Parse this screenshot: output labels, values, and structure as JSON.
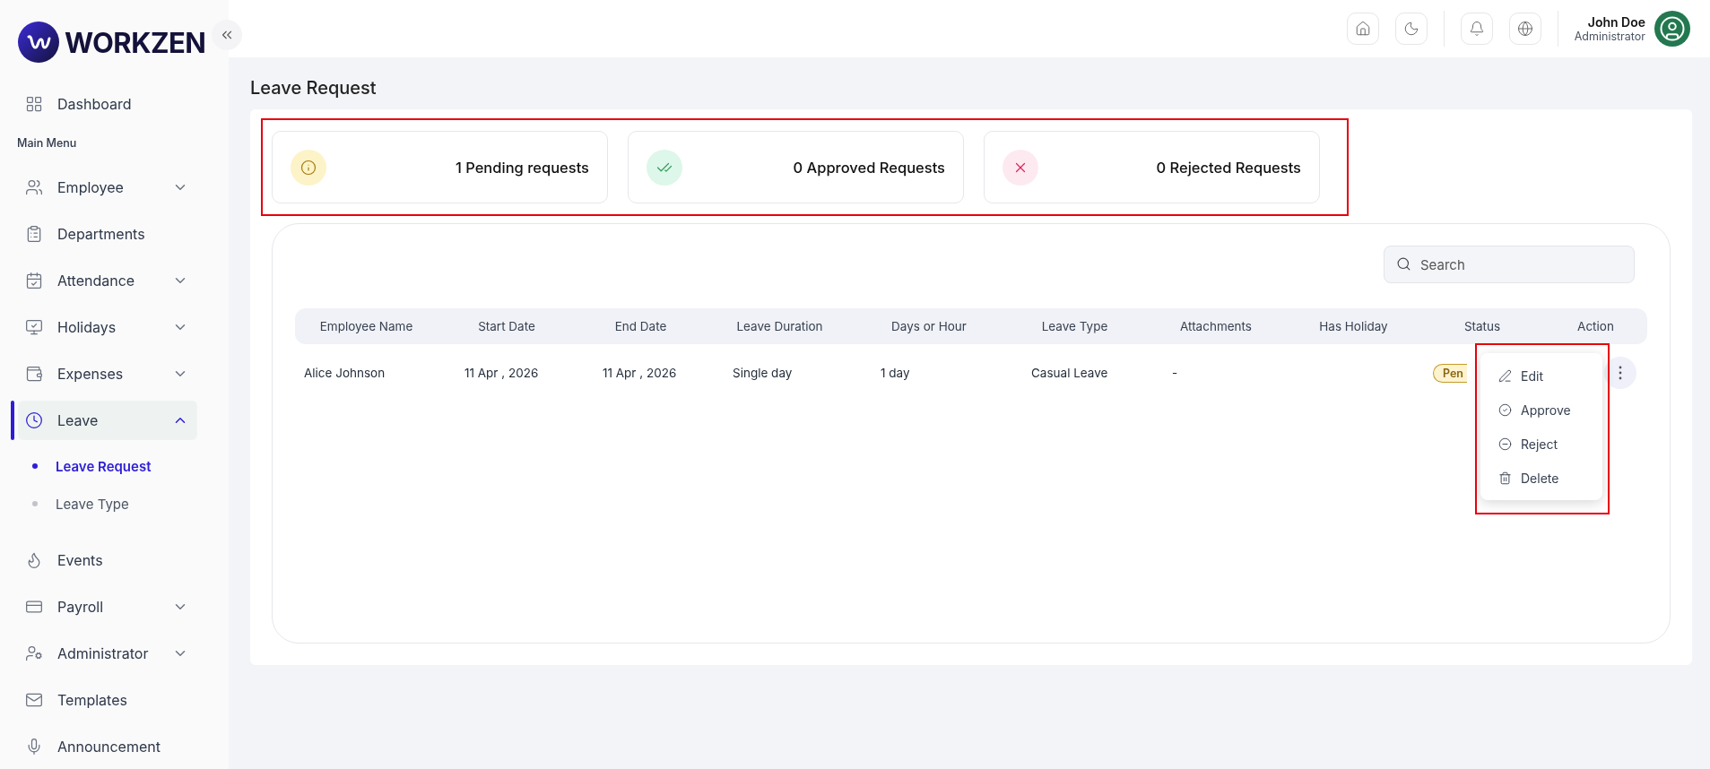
{
  "sidebar": {
    "logo": "WORKZEN",
    "top_items": [
      {
        "label": "Dashboard",
        "selected": false
      }
    ],
    "section_title": "Main Menu",
    "items": [
      {
        "label": "Employee",
        "kind": "group",
        "expanded": false,
        "selected": false
      },
      {
        "label": "Departments",
        "kind": "link",
        "selected": false
      },
      {
        "label": "Attendance",
        "kind": "group",
        "expanded": false,
        "selected": false
      },
      {
        "label": "Holidays",
        "kind": "group",
        "expanded": false,
        "selected": false
      },
      {
        "label": "Expenses",
        "kind": "group",
        "expanded": false,
        "selected": false
      },
      {
        "label": "Leave",
        "kind": "group",
        "expanded": true,
        "selected": true,
        "children": [
          {
            "label": "Leave Request",
            "selected": true
          },
          {
            "label": "Leave Type",
            "selected": false
          }
        ]
      },
      {
        "label": "Events",
        "kind": "link",
        "selected": false
      },
      {
        "label": "Payroll",
        "kind": "group",
        "expanded": false,
        "selected": false
      },
      {
        "label": "Administrator",
        "kind": "group",
        "expanded": false,
        "selected": false
      },
      {
        "label": "Templates",
        "kind": "link",
        "selected": false
      },
      {
        "label": "Announcement",
        "kind": "link",
        "selected": false
      }
    ]
  },
  "header": {
    "user": {
      "name": "John Doe",
      "role": "Administrator"
    }
  },
  "page_title": "Leave Request",
  "summary": {
    "highlighted": true,
    "cards": [
      {
        "kind": "pending",
        "text": "1 Pending requests"
      },
      {
        "kind": "approved",
        "text": "0 Approved Requests"
      },
      {
        "kind": "rejected",
        "text": "0 Rejected Requests"
      }
    ]
  },
  "search": {
    "placeholder": "Search"
  },
  "table": {
    "columns": [
      "Employee Name",
      "Start Date",
      "End Date",
      "Leave Duration",
      "Days or Hour",
      "Leave Type",
      "Attachments",
      "Has Holiday",
      "Status",
      "Action"
    ],
    "rows": [
      {
        "employee_name": "Alice Johnson",
        "start_date": "11 Apr , 2026",
        "end_date": "11 Apr , 2026",
        "leave_duration": "Single day",
        "days_or_hour": "1 day",
        "leave_type": "Casual Leave",
        "attachments": "-",
        "status": {
          "kind": "pending",
          "text": "Pen"
        }
      }
    ]
  },
  "action_menu": {
    "open": true,
    "highlighted": true,
    "items": [
      "Edit",
      "Approve",
      "Reject",
      "Delete"
    ]
  }
}
